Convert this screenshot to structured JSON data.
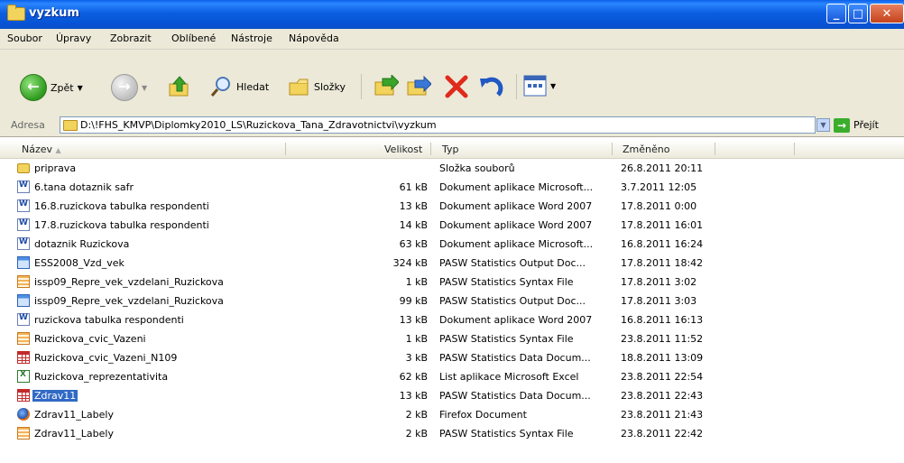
{
  "window": {
    "title": "vyzkum"
  },
  "menu": [
    "Soubor",
    "Úpravy",
    "Zobrazit",
    "Oblíbené",
    "Nástroje",
    "Nápověda"
  ],
  "toolbar": {
    "back_label": "Zpět",
    "search_label": "Hledat",
    "folders_label": "Složky"
  },
  "address": {
    "label": "Adresa",
    "path": "D:\\!FHS_KMVP\\Diplomky2010_LS\\Ruzickova_Tana_Zdravotnictvi\\vyzkum",
    "go_label": "Přejít"
  },
  "columns": {
    "name": "Název",
    "size": "Velikost",
    "type": "Typ",
    "modified": "Změněno"
  },
  "files": [
    {
      "name": "priprava",
      "size": "",
      "type": "Složka souborů",
      "modified": "26.8.2011 20:11",
      "icon": "folder-icon"
    },
    {
      "name": "6.tana dotaznik safr",
      "size": "61 kB",
      "type": "Dokument aplikace Microsoft...",
      "modified": "3.7.2011 12:05",
      "icon": "word-doc-icon"
    },
    {
      "name": "16.8.ruzickova tabulka respondenti",
      "size": "13 kB",
      "type": "Dokument aplikace Word 2007",
      "modified": "17.8.2011 0:00",
      "icon": "word-doc-icon"
    },
    {
      "name": "17.8.ruzickova tabulka respondenti",
      "size": "14 kB",
      "type": "Dokument aplikace Word 2007",
      "modified": "17.8.2011 16:01",
      "icon": "word-doc-icon"
    },
    {
      "name": "dotaznik Ruzickova",
      "size": "63 kB",
      "type": "Dokument aplikace Microsoft...",
      "modified": "16.8.2011 16:24",
      "icon": "word-doc-icon"
    },
    {
      "name": "ESS2008_Vzd_vek",
      "size": "324 kB",
      "type": "PASW Statistics Output Doc...",
      "modified": "17.8.2011 18:42",
      "icon": "spss-output-icon"
    },
    {
      "name": "issp09_Repre_vek_vzdelani_Ruzickova",
      "size": "1 kB",
      "type": "PASW Statistics Syntax File",
      "modified": "17.8.2011 3:02",
      "icon": "spss-syntax-icon"
    },
    {
      "name": "issp09_Repre_vek_vzdelani_Ruzickova",
      "size": "99 kB",
      "type": "PASW Statistics Output Doc...",
      "modified": "17.8.2011 3:03",
      "icon": "spss-output-icon"
    },
    {
      "name": "ruzickova tabulka respondenti",
      "size": "13 kB",
      "type": "Dokument aplikace Word 2007",
      "modified": "16.8.2011 16:13",
      "icon": "word-doc-icon"
    },
    {
      "name": "Ruzickova_cvic_Vazeni",
      "size": "1 kB",
      "type": "PASW Statistics Syntax File",
      "modified": "23.8.2011 11:52",
      "icon": "spss-syntax-icon"
    },
    {
      "name": "Ruzickova_cvic_Vazeni_N109",
      "size": "3 kB",
      "type": "PASW Statistics Data Docum...",
      "modified": "18.8.2011 13:09",
      "icon": "spss-data-icon"
    },
    {
      "name": "Ruzickova_reprezentativita",
      "size": "62 kB",
      "type": "List aplikace Microsoft Excel",
      "modified": "23.8.2011 22:54",
      "icon": "excel-icon"
    },
    {
      "name": "Zdrav11",
      "size": "13 kB",
      "type": "PASW Statistics Data Docum...",
      "modified": "23.8.2011 22:43",
      "icon": "spss-data-icon",
      "selected": true
    },
    {
      "name": "Zdrav11_Labely",
      "size": "2 kB",
      "type": "Firefox Document",
      "modified": "23.8.2011 21:43",
      "icon": "firefox-doc-icon"
    },
    {
      "name": "Zdrav11_Labely",
      "size": "2 kB",
      "type": "PASW Statistics Syntax File",
      "modified": "23.8.2011 22:42",
      "icon": "spss-syntax-icon"
    }
  ]
}
